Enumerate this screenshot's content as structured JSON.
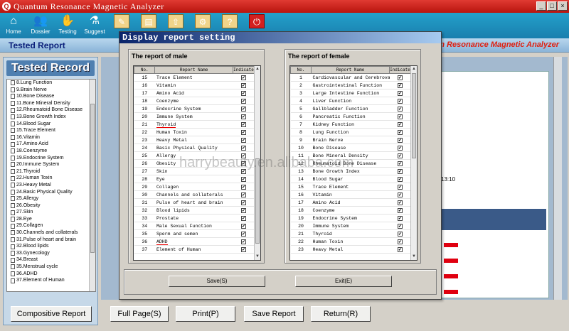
{
  "window": {
    "title": "Quantum Resonance Magnetic Analyzer",
    "minimize": "_",
    "maximize": "□",
    "close": "×"
  },
  "toolbar": [
    {
      "label": "Home",
      "icon": "home-icon",
      "glyph": "⌂"
    },
    {
      "label": "Dossier",
      "icon": "dossier-icon",
      "glyph": "👥"
    },
    {
      "label": "Testing",
      "icon": "hand-icon",
      "glyph": "✋"
    },
    {
      "label": "Suggest",
      "icon": "suggest-icon",
      "glyph": "⚗"
    },
    {
      "label": "",
      "icon": "edit-icon",
      "glyph": "✎"
    },
    {
      "label": "",
      "icon": "save-icon",
      "glyph": "▤"
    },
    {
      "label": "",
      "icon": "export-icon",
      "glyph": "⇧"
    },
    {
      "label": "",
      "icon": "settings-icon",
      "glyph": "⚙"
    },
    {
      "label": "",
      "icon": "help-icon",
      "glyph": "?"
    },
    {
      "label": "",
      "icon": "power-icon",
      "glyph": "⏻"
    }
  ],
  "header": {
    "tested_report": "Tested Report",
    "app_name": "ntum Resonance Magnetic Analyzer"
  },
  "left_panel": {
    "title": "Tested Record",
    "items": [
      "8.Lung Function",
      "9.Brain Nerve",
      "10.Bone Disease",
      "11.Bone Mineral Density",
      "12.Rheumatoid Bone Disease",
      "13.Bone Growth Index",
      "14.Blood Sugar",
      "15.Trace Element",
      "16.Vitamin",
      "17.Amino Acid",
      "18.Coenzyme",
      "19.Endocrine System",
      "20.Immune System",
      "21.Thyroid",
      "22.Human Toxin",
      "23.Heavy Metal",
      "24.Basic Physical Quality",
      "25.Allergy",
      "26.Obesity",
      "27.Skin",
      "28.Eye",
      "29.Collagen",
      "30.Channels and collaterals",
      "31.Pulse of heart and brain",
      "32.Blood lipids",
      "33.Gynecology",
      "34.Breast",
      "35.Menstrual cycle",
      "36.ADHD",
      "37.Element of Human"
    ],
    "compositive_button": "Compositive Report"
  },
  "report": {
    "time": "13:10"
  },
  "bottom_buttons": {
    "full_page": "Full Page(S)",
    "print": "Print(P)",
    "save_report": "Save Report",
    "return": "Return(R)"
  },
  "dialog": {
    "title": "Display report setting",
    "male": {
      "label": "The report of male",
      "columns": [
        "No.",
        "Report Name",
        "Indicate"
      ],
      "rows": [
        [
          "15",
          "Trace Element"
        ],
        [
          "16",
          "Vitamin"
        ],
        [
          "17",
          "Amino Acid"
        ],
        [
          "18",
          "Coenzyme"
        ],
        [
          "19",
          "Endocrine System"
        ],
        [
          "20",
          "Immune System"
        ],
        [
          "21",
          "Thyroid"
        ],
        [
          "22",
          "Human Toxin"
        ],
        [
          "23",
          "Heavy Metal"
        ],
        [
          "24",
          "Basic Physical Quality"
        ],
        [
          "25",
          "Allergy"
        ],
        [
          "26",
          "Obesity"
        ],
        [
          "27",
          "Skin"
        ],
        [
          "28",
          "Eye"
        ],
        [
          "29",
          "Collagen"
        ],
        [
          "30",
          "Channels and collaterals"
        ],
        [
          "31",
          "Pulse of heart and brain"
        ],
        [
          "32",
          "Blood lipids"
        ],
        [
          "33",
          "Prostate"
        ],
        [
          "34",
          "Male Sexual Function"
        ],
        [
          "35",
          "Sperm and semen"
        ],
        [
          "36",
          "ADHD"
        ],
        [
          "37",
          "Element of Human"
        ]
      ]
    },
    "female": {
      "label": "The report of female",
      "columns": [
        "No.",
        "Report Name",
        "Indicate"
      ],
      "rows": [
        [
          "1",
          "Cardiovascular and Cerebrovascular"
        ],
        [
          "2",
          "Gastrointestinal Function"
        ],
        [
          "3",
          "Large Intestine Function"
        ],
        [
          "4",
          "Liver Function"
        ],
        [
          "5",
          "Gallbladder Function"
        ],
        [
          "6",
          "Pancreatic Function"
        ],
        [
          "7",
          "Kidney Function"
        ],
        [
          "8",
          "Lung Function"
        ],
        [
          "9",
          "Brain Nerve"
        ],
        [
          "10",
          "Bone Disease"
        ],
        [
          "11",
          "Bone Mineral Density"
        ],
        [
          "12",
          "Rheumatoid Bone Disease"
        ],
        [
          "13",
          "Bone Growth Index"
        ],
        [
          "14",
          "Blood Sugar"
        ],
        [
          "15",
          "Trace Element"
        ],
        [
          "16",
          "Vitamin"
        ],
        [
          "17",
          "Amino Acid"
        ],
        [
          "18",
          "Coenzyme"
        ],
        [
          "19",
          "Endocrine System"
        ],
        [
          "20",
          "Immune System"
        ],
        [
          "21",
          "Thyroid"
        ],
        [
          "22",
          "Human Toxin"
        ],
        [
          "23",
          "Heavy Metal"
        ]
      ]
    },
    "save_button": "Save(S)",
    "exit_button": "Exit(E)",
    "check_glyph": "✔"
  },
  "watermark": "harrybeauty.en.alibaba.com"
}
